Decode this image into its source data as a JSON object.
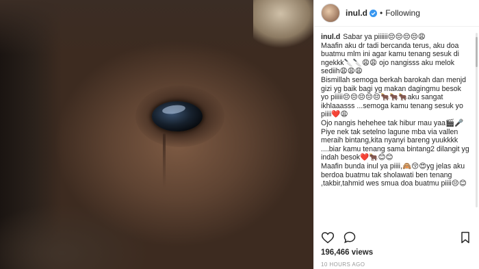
{
  "post": {
    "username": "inul.d",
    "follow_separator": "•",
    "follow_label": "Following",
    "caption_lines": [
      "Sabar ya piiiiii😔😔😔😔😩",
      "Maafin aku dr tadi bercanda terus, aku doa buatmu mlm ini agar kamu tenang sesuk di ngekkk🔪🔪😩😩 ojo nangisss aku melok sediih😩😩😩",
      "Bismillah semoga berkah barokah dan menjd gizi yg baik bagi yg makan dagingmu besok yo piiiii😔😔😔😔😔🐂🐂🐂aku sangat ikhlaaasss ...semoga kamu tenang sesuk yo piiii❤️😩",
      "Ojo nangis hehehee tak hibur mau yaa🎬🎤",
      "Piye nek tak setelno lagune mba via vallen meraih bintang,kita nyanyi bareng yuukkkk ....biar kamu tenang sama bintang2 dilangit yg indah besok❤️🐂😊😊",
      "Maafin bunda inul ya piiii,🙈😚😍yg jelas aku berdoa buatmu tak sholawati ben tenang ,takbir,tahmid wes smua doa buatmu piiii😔😊"
    ],
    "views": "196,466 views",
    "timestamp": "10 HOURS AGO"
  },
  "colors": {
    "text": "#262626",
    "muted": "#999999",
    "verified": "#3897f0",
    "border": "#efefef"
  },
  "icons": {
    "like": "heart-icon",
    "comment": "comment-icon",
    "save": "bookmark-icon",
    "verified": "verified-badge-icon"
  }
}
